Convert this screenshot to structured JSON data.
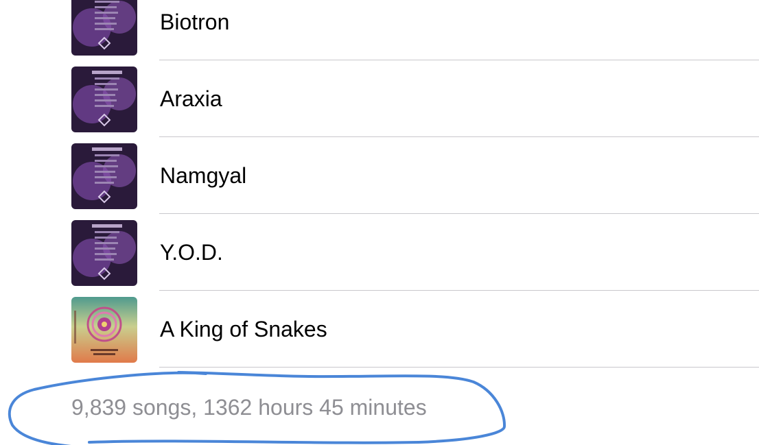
{
  "songs": [
    {
      "title": "Biotron",
      "artwork": "purple-album-artwork"
    },
    {
      "title": "Araxia",
      "artwork": "purple-album-artwork"
    },
    {
      "title": "Namgyal",
      "artwork": "purple-album-artwork"
    },
    {
      "title": "Y.O.D.",
      "artwork": "purple-album-artwork"
    },
    {
      "title": "A King of Snakes",
      "artwork": "mandala-album-artwork"
    }
  ],
  "summary": {
    "text": "9,839 songs, 1362 hours 45 minutes"
  },
  "colors": {
    "title_text": "#000000",
    "summary_text": "#8e8e93",
    "separator": "#c8c7cc",
    "annotation_stroke": "#4a86d8"
  }
}
